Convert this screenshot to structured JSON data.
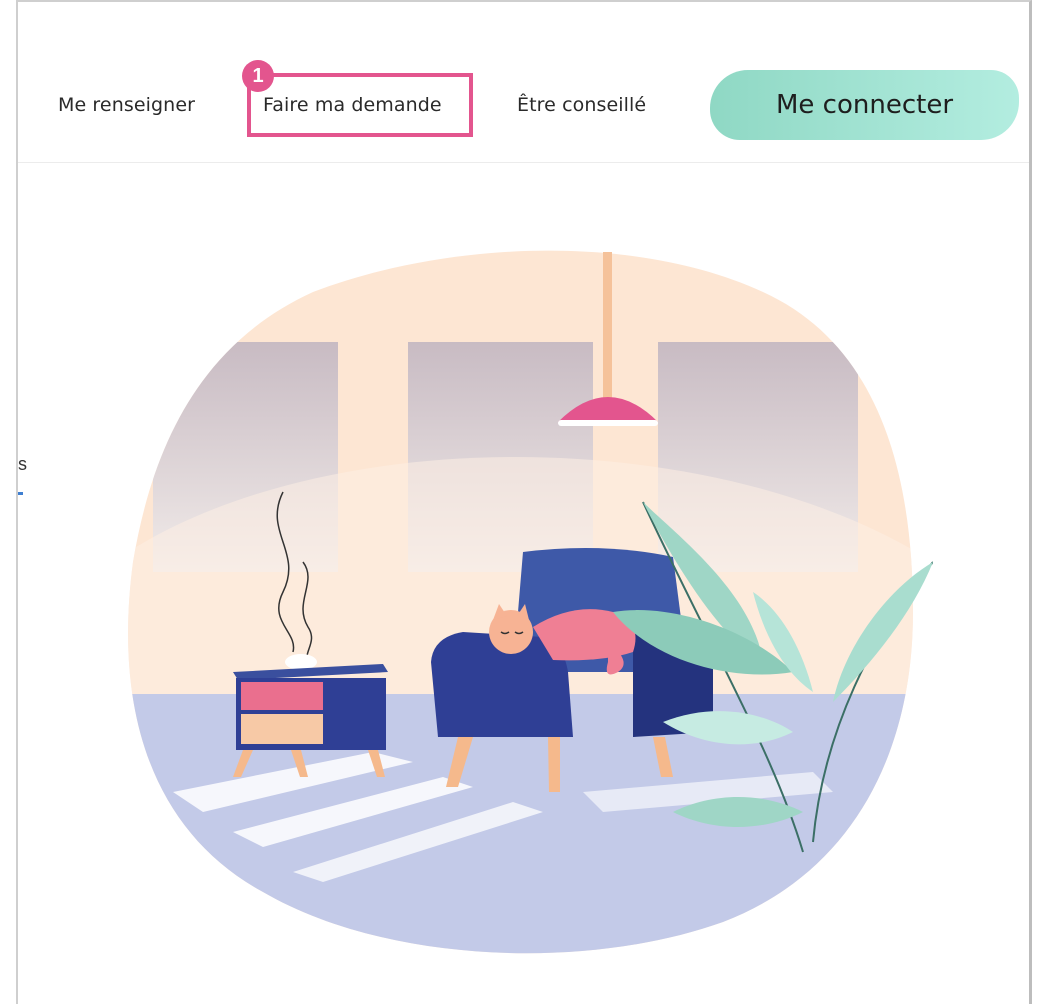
{
  "nav": {
    "items": [
      {
        "label": "Me renseigner"
      },
      {
        "label": "Faire ma demande"
      },
      {
        "label": "Être conseillé"
      }
    ],
    "connect_label": "Me connecter"
  },
  "annotation": {
    "step": "1",
    "color": "#e3558e"
  },
  "left_fragment": "s",
  "illustration": {
    "icon": "living-room-illustration",
    "colors": {
      "accent_pink": "#e3558e",
      "armchair_blue": "#2f3f95",
      "floor_lavender": "#c3cae8",
      "wall_peach": "#fde6d3",
      "leaf_mint": "#9fd6c6"
    }
  }
}
